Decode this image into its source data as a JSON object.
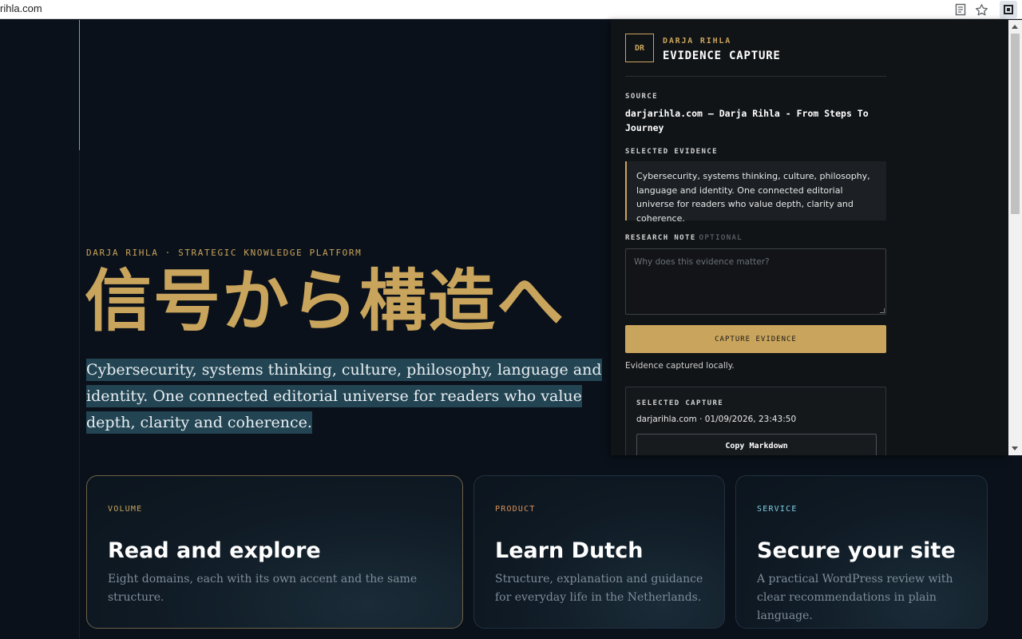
{
  "browser": {
    "url": "rihla.com",
    "icons": {
      "reader": "reader-mode-icon",
      "bookmark": "star-icon",
      "extension": "extension-icon"
    }
  },
  "hero": {
    "eyebrow": "DARJA RIHLA · STRATEGIC KNOWLEDGE PLATFORM",
    "headline": "信号から構造へ",
    "lede": "Cybersecurity, systems thinking, culture, philosophy, language and identity. One connected editorial universe for readers who value depth, clarity and coherence."
  },
  "cards": [
    {
      "tag": "VOLUME",
      "tag_color": "#c9a45c",
      "title": "Read and explore",
      "desc": "Eight domains, each with its own accent and the same structure."
    },
    {
      "tag": "PRODUCT",
      "tag_color": "#d9925a",
      "title": "Learn Dutch",
      "desc": "Structure, explanation and guidance for everyday life in the Netherlands."
    },
    {
      "tag": "SERVICE",
      "tag_color": "#7fd0e6",
      "title": "Secure your site",
      "desc": "A practical WordPress review with clear recommendations in plain language."
    }
  ],
  "panel": {
    "logo": "DR",
    "brand": "DARJA RIHLA",
    "title": "EVIDENCE CAPTURE",
    "source_label": "SOURCE",
    "source_value": "darjarihla.com — Darja Rihla - From Steps To Journey",
    "evidence_label": "SELECTED EVIDENCE",
    "evidence_text": "Cybersecurity, systems thinking, culture, philosophy, language and identity. One connected editorial universe for readers who value depth, clarity and coherence.",
    "note_label": "RESEARCH NOTE",
    "note_optional": "OPTIONAL",
    "note_placeholder": "Why does this evidence matter?",
    "note_value": "",
    "capture_button": "CAPTURE EVIDENCE",
    "status": "Evidence captured locally.",
    "capture_label": "SELECTED CAPTURE",
    "capture_meta": "darjarihla.com · 01/09/2026, 23:43:50",
    "copy_button": "Copy Markdown"
  },
  "colors": {
    "accent": "#c9a45c",
    "background": "#0a111a",
    "panel": "#111417",
    "highlight": "#234553"
  }
}
